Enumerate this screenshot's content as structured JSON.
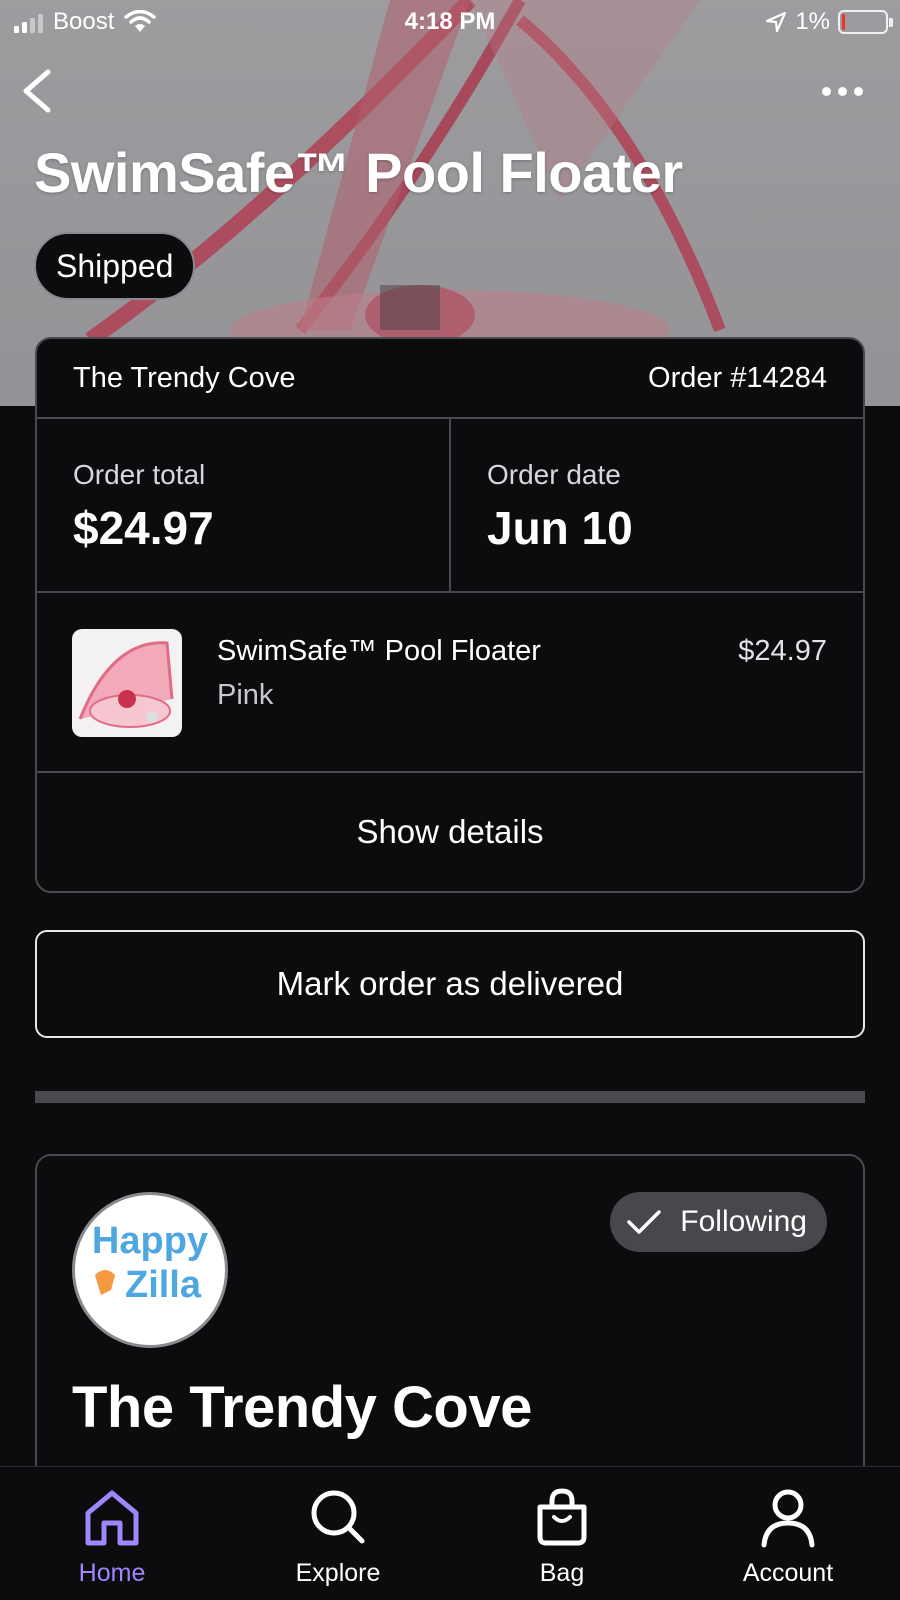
{
  "status_bar": {
    "carrier": "Boost",
    "time": "4:18 PM",
    "battery": "1%"
  },
  "product": {
    "title": "SwimSafe™ Pool Floater",
    "status": "Shipped"
  },
  "order": {
    "shop": "The Trendy Cove",
    "number": "Order #14284",
    "total_label": "Order total",
    "total_value": "$24.97",
    "date_label": "Order date",
    "date_value": "Jun 10",
    "item": {
      "name": "SwimSafe™ Pool Floater",
      "variant": "Pink",
      "price": "$24.97"
    },
    "show_details": "Show details"
  },
  "actions": {
    "mark_delivered": "Mark order as delivered"
  },
  "shop_card": {
    "logo_text_top": "Happy",
    "logo_text_bottom": "Zilla",
    "follow_label": "Following",
    "name": "The Trendy Cove"
  },
  "tabbar": {
    "home": "Home",
    "explore": "Explore",
    "bag": "Bag",
    "account": "Account"
  },
  "colors": {
    "accent": "#9f86ff",
    "background": "#0c0c0e",
    "border": "#4a4a4e",
    "battery_low": "#e8332a"
  },
  "icons": [
    "back-chevron-icon",
    "more-icon",
    "checkmark-icon",
    "home-icon",
    "search-icon",
    "bag-icon",
    "account-icon"
  ]
}
